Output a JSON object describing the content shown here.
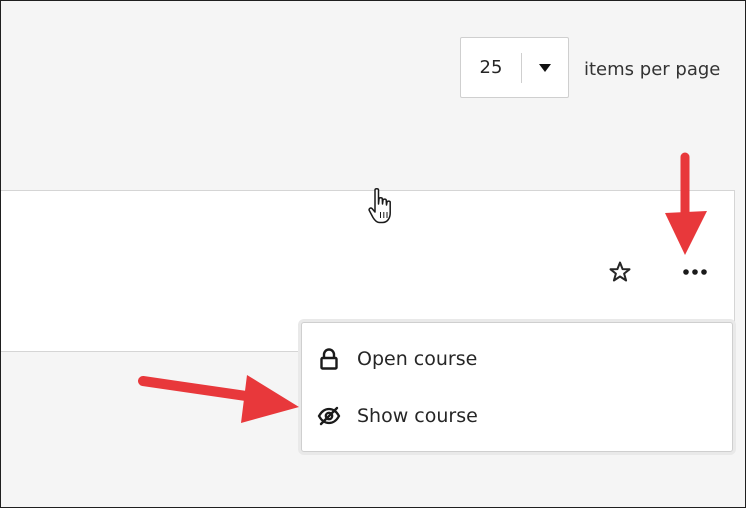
{
  "pagination": {
    "page_size": "25",
    "items_label": "items per page"
  },
  "course_menu": {
    "items": [
      {
        "label": "Open course",
        "icon": "lock-icon"
      },
      {
        "label": "Show course",
        "icon": "eye-slash-icon"
      }
    ]
  },
  "icons": {
    "favorite": "star-icon",
    "more": "ellipsis-icon",
    "dropdown": "caret-down-icon",
    "cursor": "hand-pointer-icon",
    "annotation": "red-arrow"
  },
  "colors": {
    "annotation_arrow": "#e8383b",
    "page_background": "#f5f5f5",
    "card_background": "#ffffff",
    "text": "#262626"
  }
}
